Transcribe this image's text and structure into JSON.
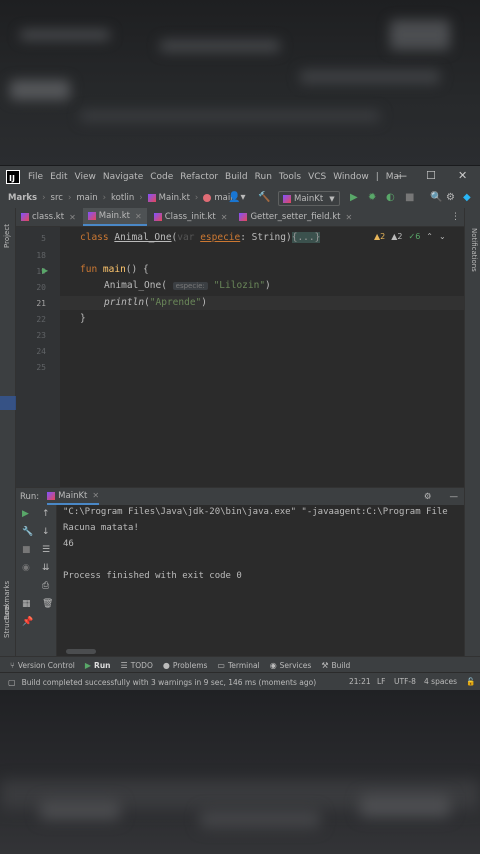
{
  "menu": {
    "items": [
      "File",
      "Edit",
      "View",
      "Navigate",
      "Code",
      "Refactor",
      "Build",
      "Run",
      "Tools",
      "VCS",
      "Window"
    ],
    "truncated": "Mai",
    "sep": "|"
  },
  "window": {
    "minimize": "—",
    "maximize": "☐",
    "close": "✕"
  },
  "breadcrumb": {
    "project": "Marks",
    "items": [
      "src",
      "main",
      "kotlin",
      "Main.kt",
      "main"
    ]
  },
  "toolbar": {
    "run_config": "MainKt"
  },
  "sidebar": {
    "project": "Project",
    "bookmarks": "Bookmarks",
    "structure": "Structure",
    "notifications": "Notifications"
  },
  "tabs": [
    {
      "label": "class.kt"
    },
    {
      "label": "Main.kt",
      "active": true
    },
    {
      "label": "Class_init.kt"
    },
    {
      "label": "Getter_setter_field.kt"
    }
  ],
  "editor": {
    "line_numbers": [
      "5",
      "18",
      "19",
      "20",
      "21",
      "22",
      "23",
      "24",
      "25"
    ],
    "inspection": {
      "warn1": "2",
      "warn2": "2",
      "ok": "6"
    },
    "code": {
      "l1_kw": "class",
      "l1_name": "Animal_One",
      "l1_open": "(",
      "l1_var": "var",
      "l1_param": "especie",
      "l1_type": ": String)",
      "l1_fold": "{...}",
      "l3_kw": "fun",
      "l3_name": "main",
      "l3_rest": "() {",
      "l4_call": "Animal_One(",
      "l4_hint": "especie:",
      "l4_str": "\"Lilozin\"",
      "l4_close": ")",
      "l5_call": "println",
      "l5_open": "(",
      "l5_str": "\"Aprende\"",
      "l5_close": ")",
      "l6": "}"
    }
  },
  "run_panel": {
    "label": "Run:",
    "tab": "MainKt",
    "console": [
      "\"C:\\Program Files\\Java\\jdk-20\\bin\\java.exe\" \"-javaagent:C:\\Program File",
      "Racuna matata!",
      "46",
      "",
      "Process finished with exit code 0"
    ]
  },
  "bottom_tools": [
    "Version Control",
    "Run",
    "TODO",
    "Problems",
    "Terminal",
    "Services",
    "Build"
  ],
  "status": {
    "message": "Build completed successfully with 3 warnings in 9 sec, 146 ms (moments ago)",
    "position": "21:21",
    "line_sep": "LF",
    "encoding": "UTF-8",
    "indent": "4 spaces"
  },
  "colors": {
    "accent": "#4a88c7",
    "keyword": "#cc7832",
    "function": "#ffc66d",
    "string": "#6a8759",
    "run_green": "#59a869"
  }
}
